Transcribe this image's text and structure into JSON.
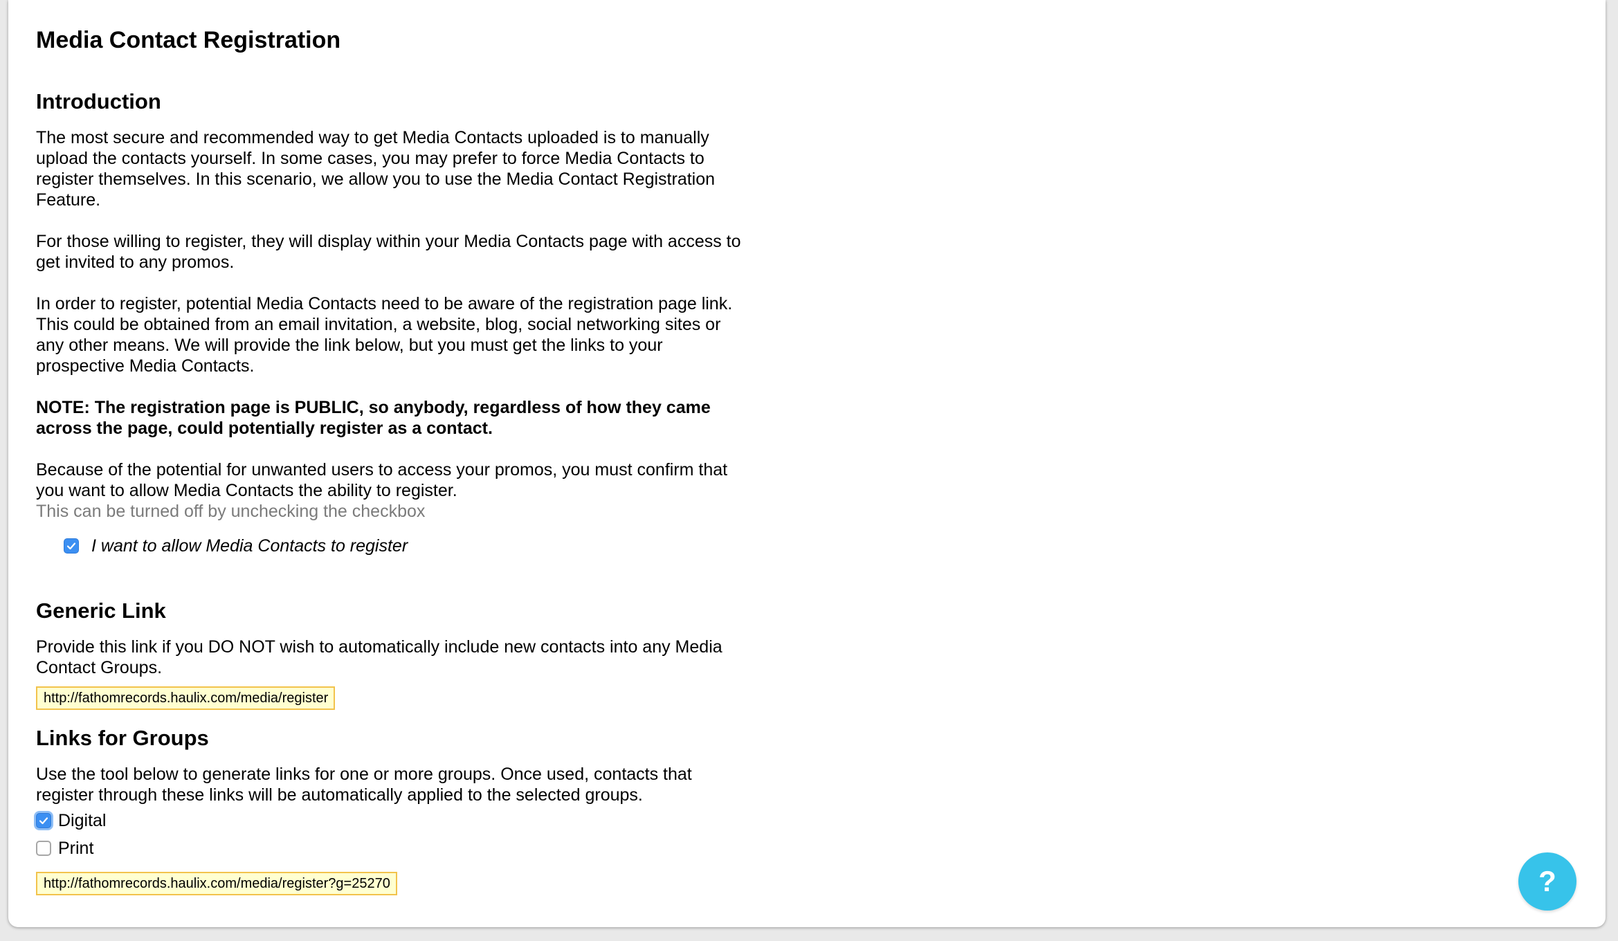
{
  "page": {
    "title": "Media Contact Registration"
  },
  "introduction": {
    "heading": "Introduction",
    "paragraph1": "The most secure and recommended way to get Media Contacts uploaded is to manually upload the contacts yourself. In some cases, you may prefer to force Media Contacts to register themselves. In this scenario, we allow you to use the Media Contact Registration Feature.",
    "paragraph2": "For those willing to register, they will display within your Media Contacts page with access to get invited to any promos.",
    "paragraph3": "In order to register, potential Media Contacts need to be aware of the registration page link. This could be obtained from an email invitation, a website, blog, social networking sites or any other means. We will provide the link below, but you must get the links to your prospective Media Contacts.",
    "note": "NOTE: The registration page is PUBLIC, so anybody, regardless of how they came across the page, could potentially register as a contact.",
    "paragraph4": "Because of the potential for unwanted users to access your promos, you must confirm that you want to allow Media Contacts the ability to register.",
    "hint": "This can be turned off by unchecking the checkbox",
    "allow_label": "I want to allow Media Contacts to register",
    "allow_checked": true
  },
  "generic_link": {
    "heading": "Generic Link",
    "description": "Provide this link if you DO NOT wish to automatically include new contacts into any Media Contact Groups.",
    "url": "http://fathomrecords.haulix.com/media/register"
  },
  "group_links": {
    "heading": "Links for Groups",
    "description": "Use the tool below to generate links for one or more groups. Once used, contacts that register through these links will be automatically applied to the selected groups.",
    "groups": [
      {
        "label": "Digital",
        "checked": true
      },
      {
        "label": "Print",
        "checked": false
      }
    ],
    "url": "http://fathomrecords.haulix.com/media/register?g=25270"
  },
  "help": {
    "label": "?",
    "icon": "question-mark-icon",
    "color": "#37c3ea"
  }
}
